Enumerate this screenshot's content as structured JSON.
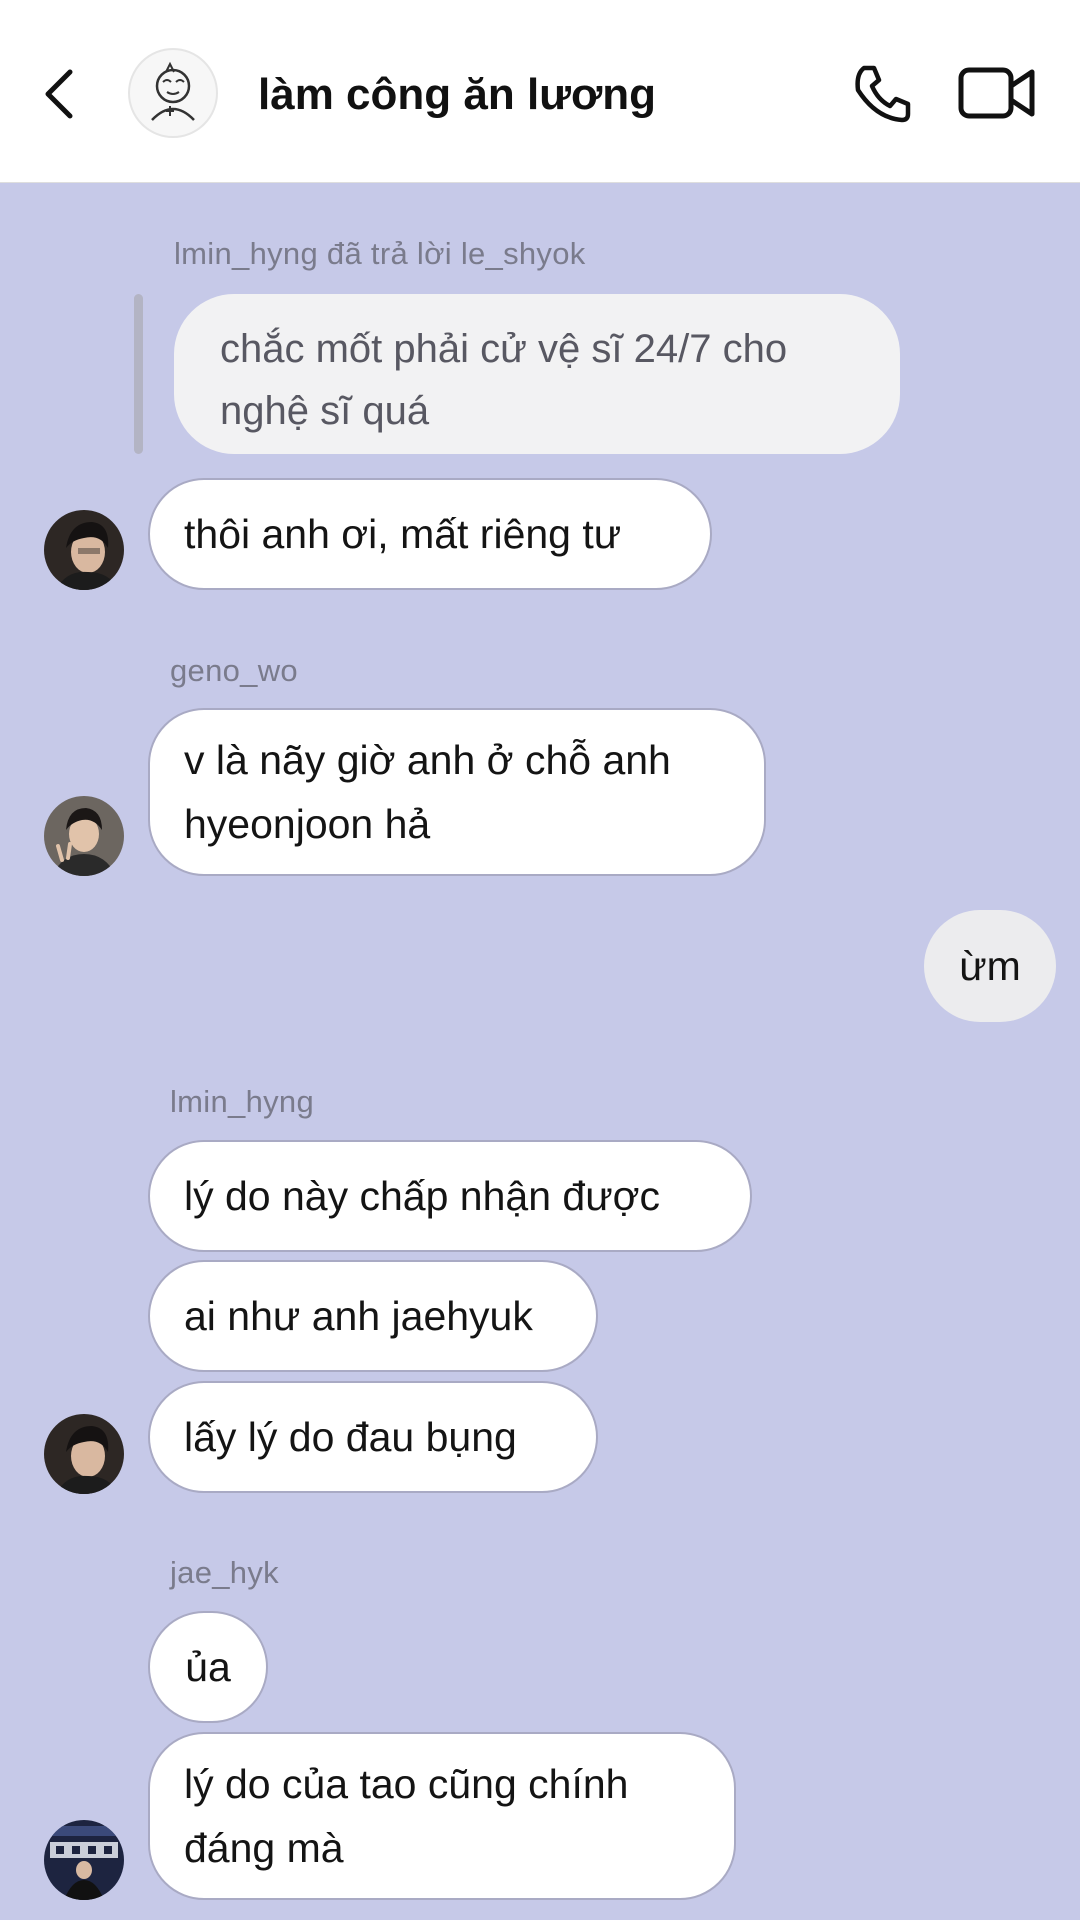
{
  "header": {
    "title": "làm công ăn lương"
  },
  "messages": {
    "reply_label": "lmin_hyng đã trả lời le_shyok",
    "reply_quote": "chắc mốt phải cử vệ sĩ 24/7 cho nghệ sĩ quá",
    "m1": "thôi anh ơi, mất riêng tư",
    "sender2": "geno_wo",
    "m2": "v là nãy giờ anh ở chỗ anh hyeonjoon hả",
    "own1": "ừm",
    "sender3": "lmin_hyng",
    "m3a": "lý do này chấp nhận được",
    "m3b": "ai như anh jaehyuk",
    "m3c": "lấy lý do đau bụng",
    "sender4": "jae_hyk",
    "m4a": "ủa",
    "m4b": "lý do của tao cũng chính đáng mà"
  },
  "icons": {
    "back": "chevron-left-icon",
    "call": "phone-icon",
    "video": "video-camera-icon",
    "group": "group-avatar-icon"
  },
  "colors": {
    "chat_background": "#c6c9e8",
    "header_background": "#ffffff",
    "bubble_background": "#ffffff",
    "bubble_border": "#a9aac4",
    "own_bubble_background": "#ececee",
    "quote_background": "#f2f2f3",
    "meta_text": "#7a7b8c"
  }
}
